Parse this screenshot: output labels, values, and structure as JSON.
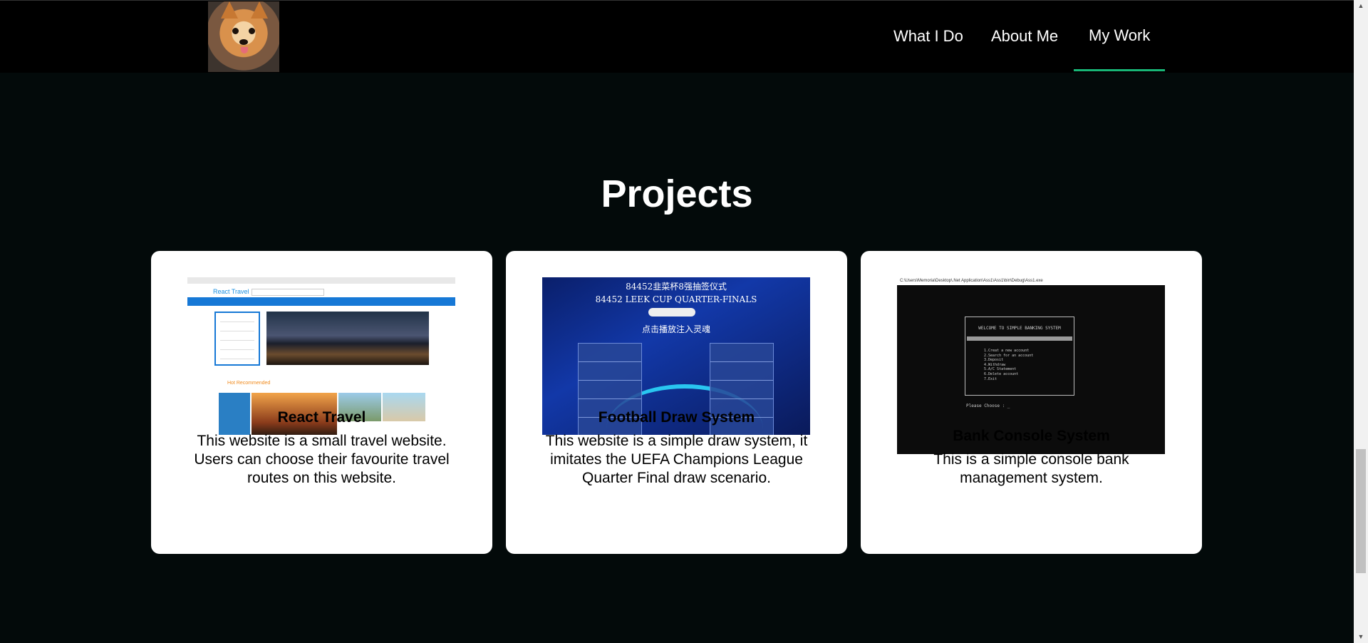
{
  "nav": {
    "items": [
      {
        "label": "What I Do"
      },
      {
        "label": "About Me"
      },
      {
        "label": "My Work",
        "active": true
      }
    ],
    "accent_color": "#18b677"
  },
  "main": {
    "title": "Projects",
    "projects": [
      {
        "title": "React Travel",
        "description": "This website is a small travel website. Users can choose their favourite travel routes on this website.",
        "preview": {
          "brand": "React Travel",
          "recommend": "Hot Recommended"
        }
      },
      {
        "title": "Football Draw System",
        "description": "This website is a simple draw system, it imitates the UEFA Champions League Quarter Final draw scenario.",
        "preview": {
          "line1": "84452韭菜杯8强抽签仪式",
          "line2": "84452 LEEK CUP QUARTER-FINALS",
          "line3": "点击播放注入灵魂"
        }
      },
      {
        "title": "Bank Console System",
        "description": "This is a simple console bank management system.",
        "preview": {
          "window_title": "C:\\Users\\Memoria\\Desktop\\.Net Application\\Ass1\\Ass1\\bin\\Debug\\Ass1.exe",
          "header": "WELCOME TO SIMPLE BANKING SYSTEM",
          "menu": "1.Creat a new account\n2.Search for an account\n3.Deposit\n4.Withdraw\n5.A/C Statement\n6.Delete account\n7.Exit",
          "prompt": "Please Choose : _"
        }
      }
    ]
  },
  "scrollbar": {
    "up": "▲",
    "down": "▼"
  }
}
